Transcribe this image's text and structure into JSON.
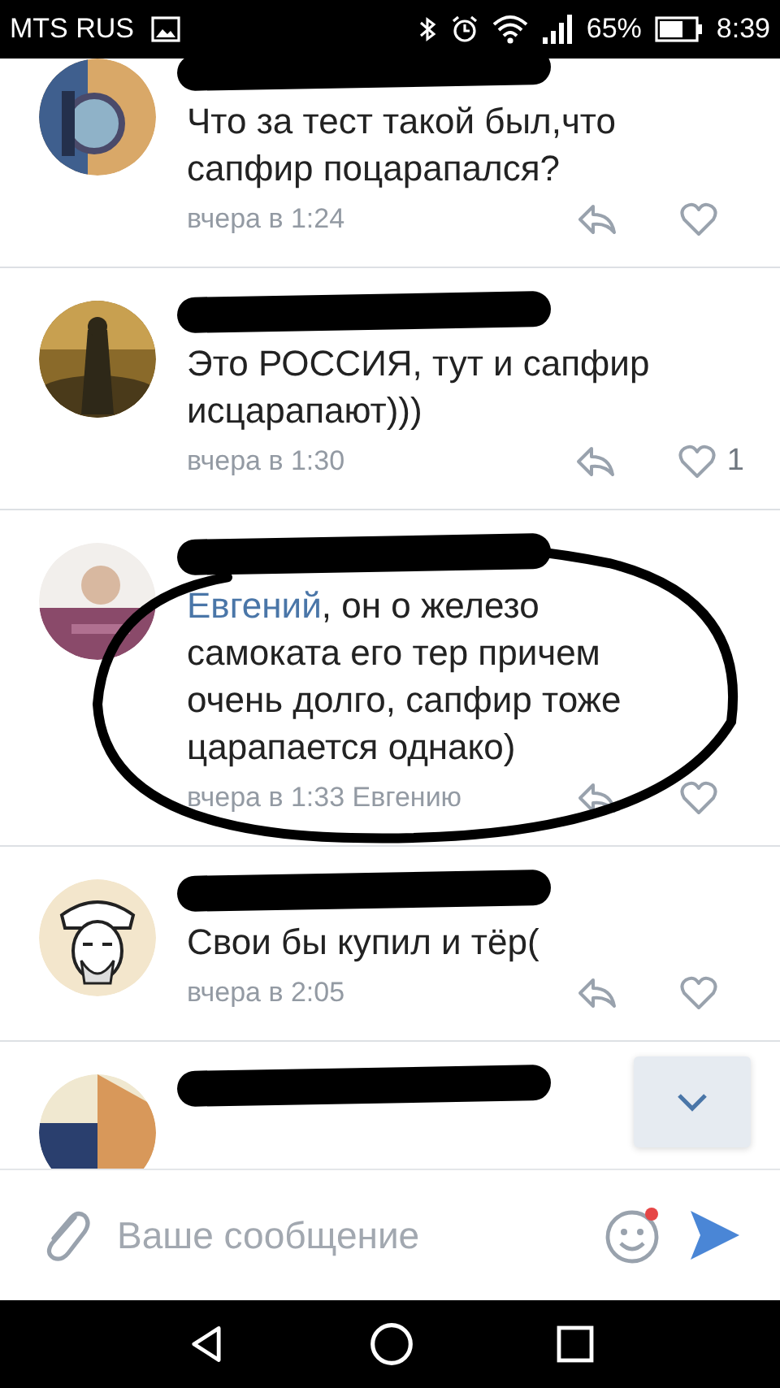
{
  "status_bar": {
    "carrier": "MTS RUS",
    "battery": "65%",
    "time": "8:39"
  },
  "comments": [
    {
      "kind": "full",
      "text": "Что за тест такой был,что сапфир поцарапался?",
      "time": "вчера в 1:24"
    },
    {
      "kind": "full",
      "text": "Это РОССИЯ, тут и сапфир исцарапают)))",
      "time": "вчера в 1:30",
      "like_count": "1"
    },
    {
      "kind": "full",
      "reply_to": "Евгений",
      "text": ", он о железо самоката его тер причем очень долго, сапфир тоже царапается однако)",
      "time": "вчера в 1:33",
      "addressee": "Евгению"
    },
    {
      "kind": "full",
      "text": "Свои бы купил и тёр(",
      "time": "вчера в 2:05"
    },
    {
      "kind": "cut"
    }
  ],
  "composer": {
    "placeholder": "Ваше сообщение"
  }
}
